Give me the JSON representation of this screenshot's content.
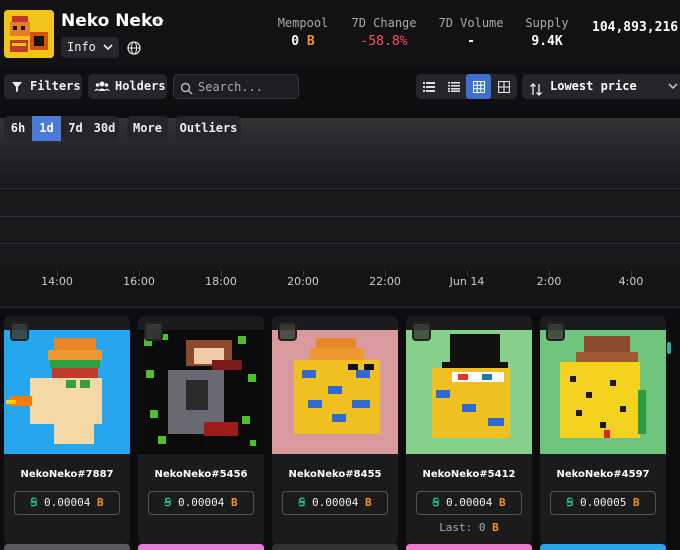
{
  "collection": {
    "title": "Neko Neko",
    "info_label": "Info"
  },
  "stats": [
    {
      "label": "Mempool",
      "value": "0",
      "unit": "B"
    },
    {
      "label": "7D Change",
      "value": "-58.8%"
    },
    {
      "label": "7D Volume",
      "value": "-"
    },
    {
      "label": "Supply",
      "value": "9.4K"
    },
    {
      "label": "",
      "value": "104,893,216"
    }
  ],
  "toolbar": {
    "filters_label": "Filters",
    "holders_label": "Holders",
    "search_placeholder": "Search...",
    "sort_label": "Lowest price",
    "active_view": "grid-small"
  },
  "time_ranges": [
    "6h",
    "1d",
    "7d",
    "30d"
  ],
  "active_time_range": "1d",
  "more_label": "More",
  "outliers_label": "Outliers",
  "chart": {
    "x_ticks": [
      "14:00",
      "16:00",
      "18:00",
      "20:00",
      "22:00",
      "Jun 14",
      "2:00",
      "4:00"
    ]
  },
  "items": [
    {
      "name": "NekoNeko#7887",
      "price": "0.00004",
      "bg": "#27a6f0"
    },
    {
      "name": "NekoNeko#5456",
      "price": "0.00004",
      "bg": "#0b0b0b"
    },
    {
      "name": "NekoNeko#8455",
      "price": "0.00004",
      "bg": "#d89a9c"
    },
    {
      "name": "NekoNeko#5412",
      "price": "0.00004",
      "bg": "#86d08c",
      "last": "Last: 0"
    },
    {
      "name": "NekoNeko#4597",
      "price": "0.00005",
      "bg": "#6fc57d"
    }
  ],
  "colors": {
    "accent": "#3b6fd1",
    "btc": "#f7931a",
    "negative": "#ff4d5e"
  }
}
